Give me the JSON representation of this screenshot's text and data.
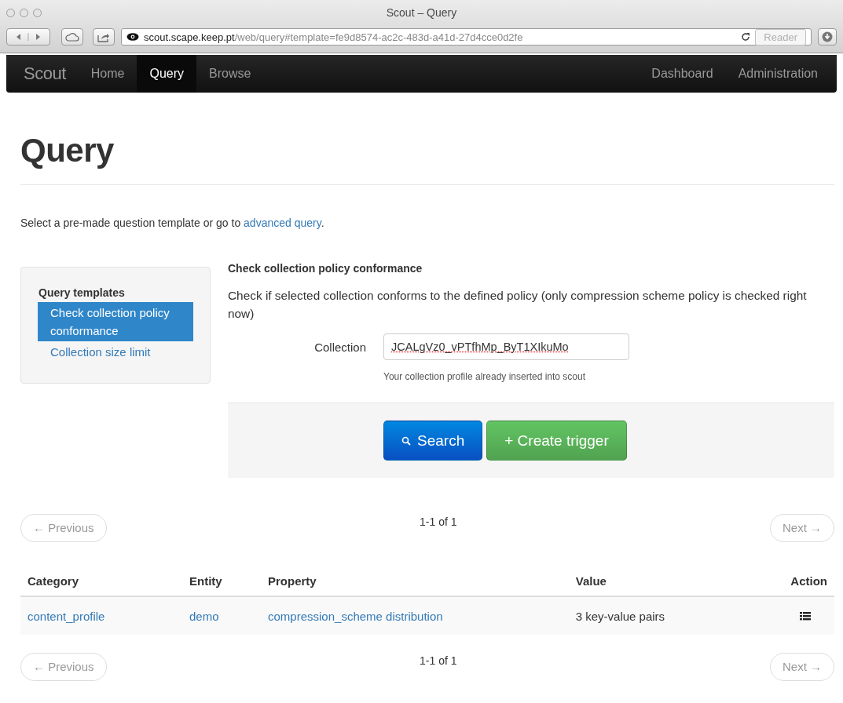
{
  "window": {
    "title": "Scout – Query"
  },
  "toolbar": {
    "url_host": "scout.scape.keep.pt",
    "url_path": "/web/query#template=fe9d8574-ac2c-483d-a41d-27d4cce0d2fe",
    "reader": "Reader"
  },
  "navbar": {
    "brand": "Scout",
    "items": [
      {
        "label": "Home",
        "selected": false
      },
      {
        "label": "Query",
        "selected": true
      },
      {
        "label": "Browse",
        "selected": false
      }
    ],
    "right_items": [
      {
        "label": "Dashboard",
        "selected": false
      },
      {
        "label": "Administration",
        "selected": false
      }
    ]
  },
  "page": {
    "title": "Query",
    "intro": "Select a pre-made question template or go to ",
    "intro_link": "advanced query",
    "intro_end": "."
  },
  "sidebar": {
    "header": "Query templates",
    "items": [
      {
        "label": "Check collection policy conformance",
        "selected": true
      },
      {
        "label": "Collection size limit",
        "selected": false
      }
    ]
  },
  "template": {
    "title": "Check collection policy conformance",
    "description": "Check if selected collection conforms to the defined policy (only compression scheme policy is checked right now)",
    "field_label": "Collection",
    "field_value": "JCALgVz0_vPTfhMp_ByT1XIkuMo",
    "field_help": "Your collection profile already inserted into scout",
    "buttons": [
      {
        "kind": "primary",
        "label": "Search"
      },
      {
        "kind": "success",
        "label": "+ Create trigger"
      }
    ]
  },
  "pager_top": {
    "previous": "← Previous",
    "next": "Next →",
    "info": "1-1 of 1",
    "disabled": true
  },
  "table": {
    "columns": [
      "Category",
      "Entity",
      "Property",
      "Value",
      "Action"
    ],
    "rows": [
      {
        "category": "content_profile",
        "entity": "demo",
        "property": "compression_scheme distribution",
        "value": "3 key-value pairs"
      }
    ]
  },
  "pager_bottom": {
    "previous": "← Previous",
    "next": "Next →",
    "info": "1-1 of 1",
    "disabled": true
  }
}
